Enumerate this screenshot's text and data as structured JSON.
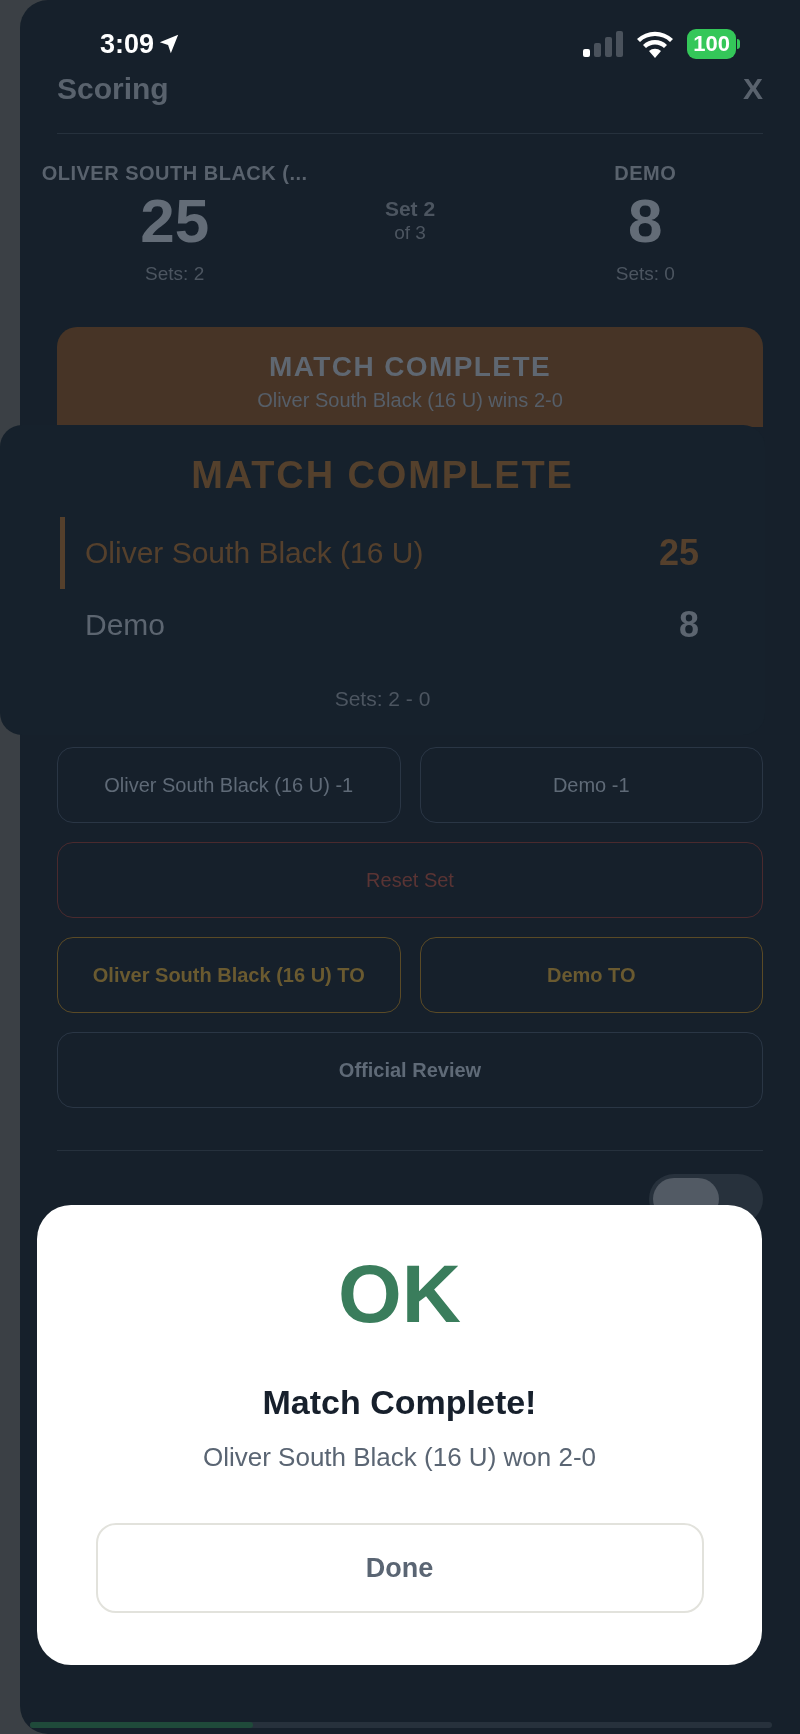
{
  "status_bar": {
    "time": "3:09",
    "battery": "100"
  },
  "header": {
    "title": "Scoring",
    "close": "X"
  },
  "scoreboard": {
    "teams": [
      {
        "name": "OLIVER SOUTH BLACK (...",
        "score": "25",
        "sets": "Sets: 2"
      },
      {
        "name": "DEMO",
        "score": "8",
        "sets": "Sets: 0"
      }
    ],
    "set_label": "Set 2",
    "set_of": "of 3"
  },
  "banner": {
    "title": "MATCH COMPLETE",
    "subtitle": "Oliver South Black (16 U) wins 2-0"
  },
  "result_card": {
    "title": "MATCH COMPLETE",
    "rows": [
      {
        "name": "Oliver South Black (16 U)",
        "score": "25",
        "winner": true
      },
      {
        "name": "Demo",
        "score": "8",
        "winner": false
      }
    ],
    "sets": "Sets: 2 - 0"
  },
  "actions": [
    [
      {
        "label": "Oliver South Black (16 U) -1",
        "kind": "minus"
      },
      {
        "label": "Demo -1",
        "kind": "minus"
      }
    ],
    [
      {
        "label": "Reset Set",
        "kind": "danger"
      }
    ],
    [
      {
        "label": "Oliver South Black (16 U) TO",
        "kind": "timeout"
      },
      {
        "label": "Demo TO",
        "kind": "timeout"
      }
    ],
    [
      {
        "label": "Official Review",
        "kind": "review"
      }
    ]
  ],
  "toggle": {
    "on": false
  },
  "dialog": {
    "icon_text": "OK",
    "title": "Match Complete!",
    "message": "Oliver South Black (16 U) won 2-0",
    "button": "Done"
  },
  "progress": {
    "level": 0.3
  }
}
